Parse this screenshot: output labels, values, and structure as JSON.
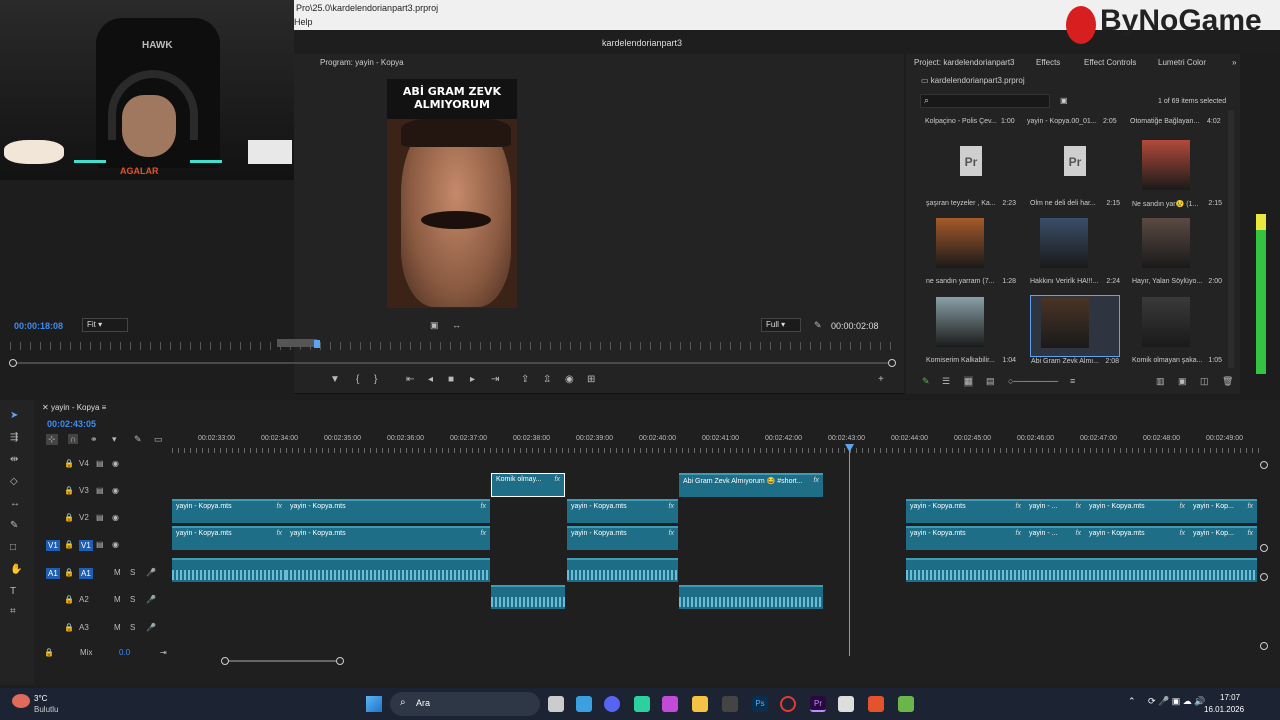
{
  "titlebar": {
    "path": "Pro\\25.0\\kardelendorianpart3.prproj",
    "menu_help": "Help"
  },
  "app": {
    "project_title": "kardelendorianpart3"
  },
  "watermark": {
    "text": "ByNoGame"
  },
  "webcam": {
    "chair_text": "HAWK",
    "overlay_text": "AGALAR"
  },
  "program": {
    "title": "Program: yayin - Kopya",
    "video_caption": "ABİ GRAM ZEVK ALMIYORUM",
    "current_time": "00:00:18:08",
    "fit_select": "Fit",
    "quality_select": "Full",
    "duration": "00:00:02:08"
  },
  "project": {
    "tabs": [
      "Project: kardelendorianpart3",
      "Effects",
      "Effect Controls",
      "Lumetri Color"
    ],
    "file": "kardelendorianpart3.prproj",
    "selection_info": "1 of 69 items selected",
    "top_row": [
      {
        "name": "Kolpaçino - Polis Çev...",
        "dur": "1:00"
      },
      {
        "name": "yayin - Kopya.00_01...",
        "dur": "2:05"
      },
      {
        "name": "Otomatiğe Bağlayan...",
        "dur": "4:02"
      }
    ],
    "items": [
      {
        "name": "şaşıran teyzeler , Ka...",
        "dur": "2:23",
        "kind": "pr",
        "color": "#cfcfcf"
      },
      {
        "name": "Olm ne deli deli har...",
        "dur": "2:15",
        "kind": "pr",
        "color": "#cfcfcf"
      },
      {
        "name": "Ne sandın yar😢 (1...",
        "dur": "2:15",
        "kind": "video",
        "color": "#b24a3a"
      },
      {
        "name": "ne sandın yarram (7...",
        "dur": "1:28",
        "kind": "video",
        "color": "#a55a2a"
      },
      {
        "name": "Hakkını Verirlk HA!!!...",
        "dur": "2:24",
        "kind": "video",
        "color": "#3a4e6a"
      },
      {
        "name": "Hayır, Yalan Söylüyo...",
        "dur": "2:00",
        "kind": "video",
        "color": "#5a4a42"
      },
      {
        "name": "Komiserim Kalkabilir...",
        "dur": "1:04",
        "kind": "video",
        "color": "#8aa0a6"
      },
      {
        "name": "Abi Gram Zevk Almı...",
        "dur": "2:08",
        "kind": "video",
        "color": "#4a3426"
      },
      {
        "name": "Komik olmayan şaka...",
        "dur": "1:05",
        "kind": "video",
        "color": "#3a3a3a"
      }
    ]
  },
  "timeline": {
    "sequence_tab": "yayin - Kopya",
    "timecode": "00:02:43:05",
    "ruler": [
      "00:02:33:00",
      "00:02:34:00",
      "00:02:35:00",
      "00:02:36:00",
      "00:02:37:00",
      "00:02:38:00",
      "00:02:39:00",
      "00:02:40:00",
      "00:02:41:00",
      "00:02:42:00",
      "00:02:43:00",
      "00:02:44:00",
      "00:02:45:00",
      "00:02:46:00",
      "00:02:47:00",
      "00:02:48:00",
      "00:02:49:00"
    ],
    "tracks": [
      {
        "label": "V4",
        "kind": "video"
      },
      {
        "label": "V3",
        "kind": "video"
      },
      {
        "label": "V2",
        "kind": "video"
      },
      {
        "label": "V1",
        "kind": "video",
        "source": "V1"
      },
      {
        "label": "A1",
        "kind": "audio",
        "source": "A1"
      },
      {
        "label": "A2",
        "kind": "audio"
      },
      {
        "label": "A3",
        "kind": "audio"
      }
    ],
    "mix_label": "Mix",
    "mix_value": "0.0",
    "clip_main": "yayin - Kopya.mts",
    "clip_short": "yayin - Kop...",
    "clip_short2": "yayin - ...",
    "clip_v3a": "Komik olmay...",
    "clip_v3b": "Abi Gram Zevk Almıyorum 😂 #short..."
  },
  "taskbar": {
    "weather_temp": "3°C",
    "weather_desc": "Bulutlu",
    "search": "Ara",
    "time": "17:07",
    "date": "16.01.2026"
  }
}
